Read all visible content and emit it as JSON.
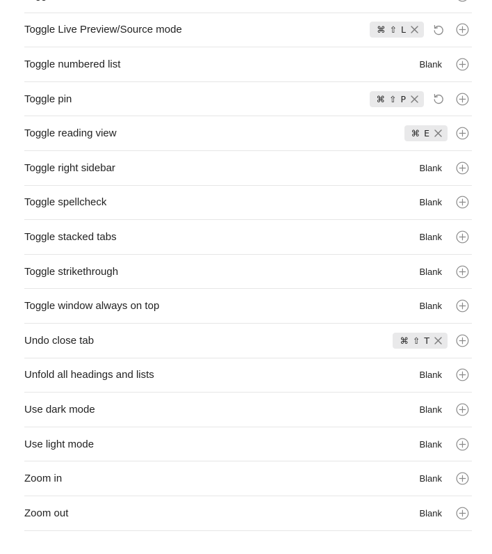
{
  "hotkeys": {
    "rows": [
      {
        "name": "Toggle",
        "hotkey": "",
        "restore": false
      },
      {
        "name": "Toggle Live Preview/Source mode",
        "hotkey": "⌘ ⇧ L",
        "restore": true
      },
      {
        "name": "Toggle numbered list",
        "hotkey": "",
        "restore": false
      },
      {
        "name": "Toggle pin",
        "hotkey": "⌘ ⇧ P",
        "restore": true
      },
      {
        "name": "Toggle reading view",
        "hotkey": "⌘ E",
        "restore": false
      },
      {
        "name": "Toggle right sidebar",
        "hotkey": "",
        "restore": false
      },
      {
        "name": "Toggle spellcheck",
        "hotkey": "",
        "restore": false
      },
      {
        "name": "Toggle stacked tabs",
        "hotkey": "",
        "restore": false
      },
      {
        "name": "Toggle strikethrough",
        "hotkey": "",
        "restore": false
      },
      {
        "name": "Toggle window always on top",
        "hotkey": "",
        "restore": false
      },
      {
        "name": "Undo close tab",
        "hotkey": "⌘ ⇧ T",
        "restore": false
      },
      {
        "name": "Unfold all headings and lists",
        "hotkey": "",
        "restore": false
      },
      {
        "name": "Use dark mode",
        "hotkey": "",
        "restore": false
      },
      {
        "name": "Use light mode",
        "hotkey": "",
        "restore": false
      },
      {
        "name": "Zoom in",
        "hotkey": "",
        "restore": false
      },
      {
        "name": "Zoom out",
        "hotkey": "",
        "restore": false
      }
    ],
    "blank_label": "Blank"
  },
  "icons": {
    "delete": "x-icon",
    "restore": "restore-icon",
    "add": "plus-circle-icon"
  },
  "colors": {
    "icon": "#8a8a8a",
    "chip_bg": "#e9e9ea",
    "divider": "#e6e6e6"
  }
}
